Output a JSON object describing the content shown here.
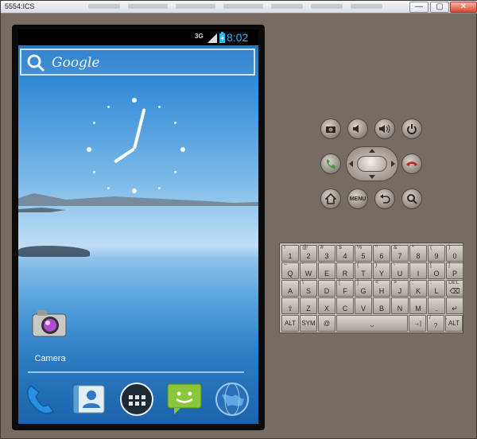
{
  "window": {
    "title": "5554:ICS",
    "min": "—",
    "max": "▢",
    "close": "✕"
  },
  "status": {
    "network": "3G",
    "time": "8:02"
  },
  "search": {
    "label": "Google"
  },
  "shortcut": {
    "camera_label": "Camera"
  },
  "hardware_buttons": {
    "menu_label": "MENU"
  },
  "keyboard": {
    "row1": [
      {
        "sub": "!",
        "main": "1"
      },
      {
        "sub": "@",
        "main": "2"
      },
      {
        "sub": "#",
        "main": "3"
      },
      {
        "sub": "$",
        "main": "4"
      },
      {
        "sub": "%",
        "main": "5"
      },
      {
        "sub": "^",
        "main": "6"
      },
      {
        "sub": "&",
        "main": "7"
      },
      {
        "sub": "*",
        "main": "8"
      },
      {
        "sub": "(",
        "main": "9"
      },
      {
        "sub": ")",
        "main": "0"
      }
    ],
    "row2": [
      {
        "sub": "~",
        "main": "Q"
      },
      {
        "sub": "\"",
        "main": "W"
      },
      {
        "sub": "´",
        "main": "E"
      },
      {
        "sub": "",
        "main": "R"
      },
      {
        "sub": "{",
        "main": "T"
      },
      {
        "sub": "}",
        "main": "Y"
      },
      {
        "sub": "-",
        "main": "U"
      },
      {
        "sub": "",
        "main": "I"
      },
      {
        "sub": "[",
        "main": "O"
      },
      {
        "sub": "]",
        "main": "P"
      }
    ],
    "row3": [
      {
        "sub": "",
        "main": "A"
      },
      {
        "sub": "\\",
        "main": "S"
      },
      {
        "sub": "",
        "main": "D"
      },
      {
        "sub": "[",
        "main": "F"
      },
      {
        "sub": "]",
        "main": "G"
      },
      {
        "sub": "<",
        "main": "H"
      },
      {
        "sub": ">",
        "main": "J"
      },
      {
        "sub": ";",
        "main": "K"
      },
      {
        "sub": ":",
        "main": "L"
      },
      {
        "sub": "DEL",
        "main": "⌫"
      }
    ],
    "row4": [
      {
        "sub": "",
        "main": "⇧"
      },
      {
        "sub": "",
        "main": "Z"
      },
      {
        "sub": "",
        "main": "X"
      },
      {
        "sub": "",
        "main": "C"
      },
      {
        "sub": "",
        "main": "V"
      },
      {
        "sub": "",
        "main": "B"
      },
      {
        "sub": "",
        "main": "N"
      },
      {
        "sub": "",
        "main": "M"
      },
      {
        "sub": "",
        "main": "."
      },
      {
        "sub": "",
        "main": "↵"
      }
    ],
    "row5": {
      "alt_left": "ALT",
      "sym": "SYM",
      "at": "@",
      "space": "⎵",
      "arrow": "→|",
      "slash": "/",
      "q": "?",
      "comma": ",",
      "alt_right": "ALT"
    }
  },
  "colors": {
    "accent": "#36b4f2",
    "call_green": "#3f9b3f",
    "end_red": "#d02020"
  }
}
